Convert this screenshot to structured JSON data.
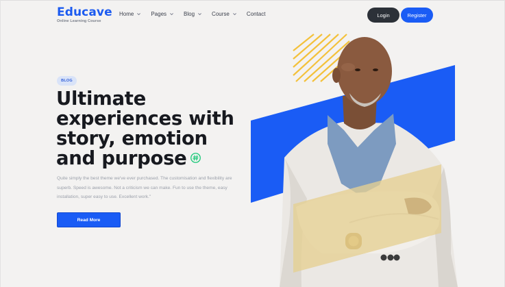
{
  "brand": {
    "title": "Educave",
    "subtitle": "Online Learning Course",
    "accent": "#1a5cf5"
  },
  "nav": {
    "items": [
      {
        "label": "Home",
        "has_dropdown": true
      },
      {
        "label": "Pages",
        "has_dropdown": true
      },
      {
        "label": "Blog",
        "has_dropdown": true
      },
      {
        "label": "Course",
        "has_dropdown": true
      },
      {
        "label": "Contact",
        "has_dropdown": false
      }
    ],
    "login_label": "Login",
    "register_label": "Register"
  },
  "hero": {
    "badge": "BLOG",
    "headline_lines": [
      "Ultimate",
      "experiences with",
      "story, emotion",
      "and purpose"
    ],
    "headline_icon": "hashtag-icon",
    "paragraph": "Quite simply the best theme we've ever purchased. The customisation and flexibility are superb. Speed is awesome. Not a criticism we can make. Fun to use the theme, easy installation, super easy to use. Excellent work.\"",
    "cta_label": "Read More"
  },
  "colors": {
    "blue_shape": "#1a5cf5",
    "yellow_stripes": "#f3c13a",
    "tan_shape": "#e6cf92",
    "dark_button": "#2c3138",
    "icon_green": "#1ec97a"
  }
}
